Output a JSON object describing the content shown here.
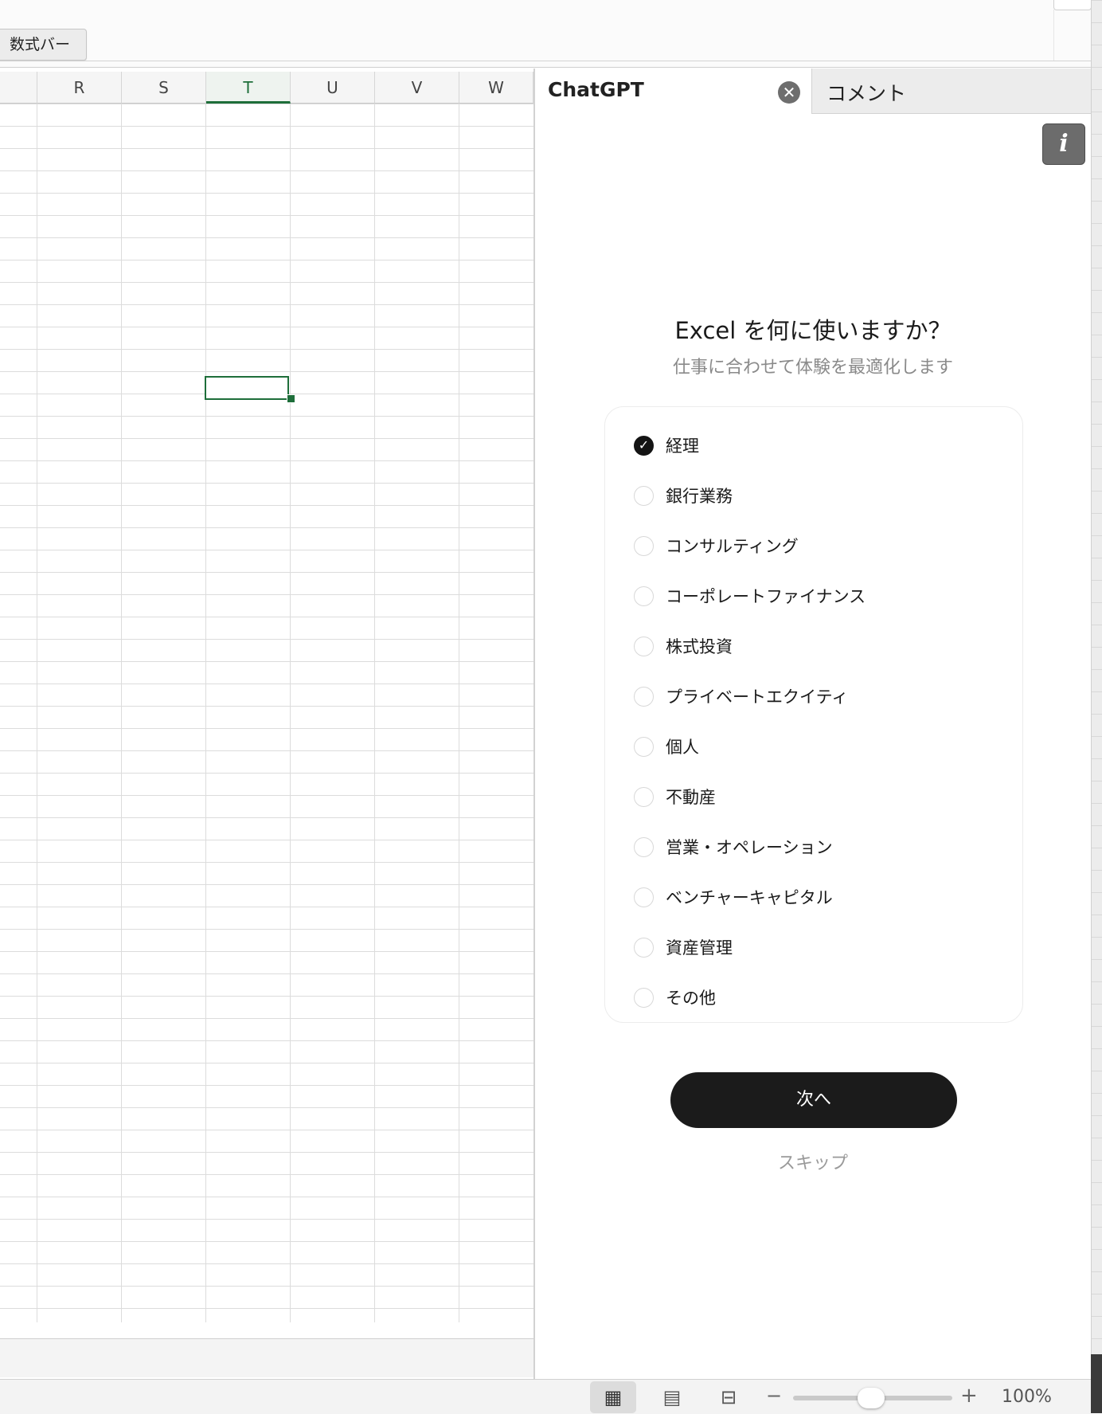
{
  "toolbar": {
    "formula_bar_label": "数式バー"
  },
  "sheet": {
    "columns": [
      {
        "label": "R",
        "active": false
      },
      {
        "label": "S",
        "active": false
      },
      {
        "label": "T",
        "active": true
      },
      {
        "label": "U",
        "active": false
      },
      {
        "label": "V",
        "active": false
      },
      {
        "label": "W",
        "active": false
      }
    ],
    "accent_color": "#1e6e3a"
  },
  "panel": {
    "tab_chatgpt": "ChatGPT",
    "tab_comments": "コメント",
    "info_label": "i",
    "title": "Excel を何に使いますか？",
    "subtitle": "仕事に合わせて体験を最適化します",
    "options": [
      {
        "label": "経理",
        "selected": true
      },
      {
        "label": "銀行業務",
        "selected": false
      },
      {
        "label": "コンサルティング",
        "selected": false
      },
      {
        "label": "コーポレートファイナンス",
        "selected": false
      },
      {
        "label": "株式投資",
        "selected": false
      },
      {
        "label": "プライベートエクイティ",
        "selected": false
      },
      {
        "label": "個人",
        "selected": false
      },
      {
        "label": "不動産",
        "selected": false
      },
      {
        "label": "営業・オペレーション",
        "selected": false
      },
      {
        "label": "ベンチャーキャピタル",
        "selected": false
      },
      {
        "label": "資産管理",
        "selected": false
      },
      {
        "label": "その他",
        "selected": false
      }
    ],
    "next_label": "次へ",
    "skip_label": "スキップ"
  },
  "status": {
    "zoom_minus": "−",
    "zoom_plus": "+",
    "zoom_value": "100%",
    "zoom_level_percent": 100
  }
}
